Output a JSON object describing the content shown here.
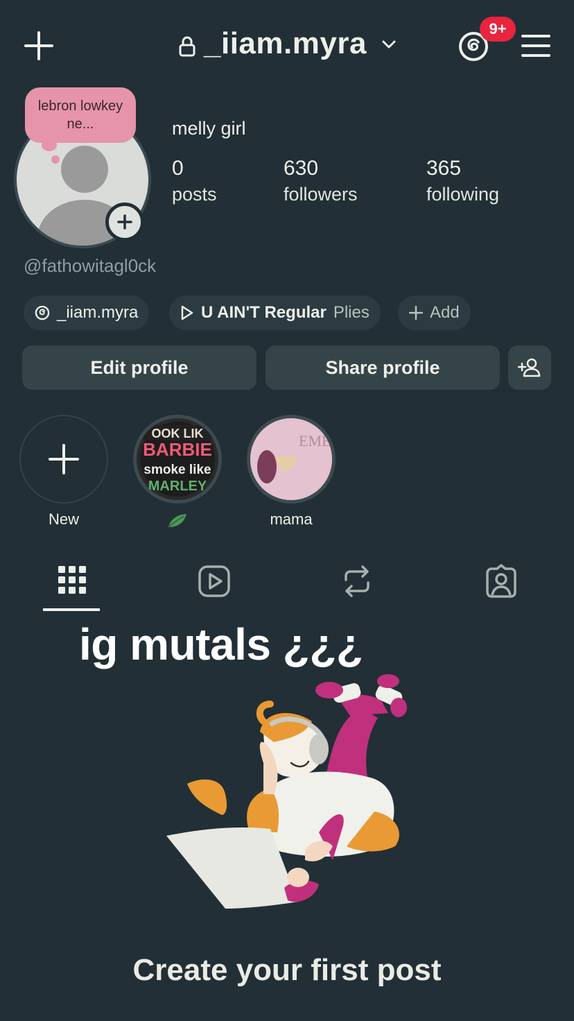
{
  "header": {
    "username": "_iiam.myra",
    "notification_badge": "9+",
    "badge_color": "#e8243f"
  },
  "profile": {
    "note": "lebron lowkey ne...",
    "full_name": "melly girl",
    "handle": "@fathowitagl0ck",
    "stats": [
      {
        "value": "0",
        "label": "posts"
      },
      {
        "value": "630",
        "label": "followers"
      },
      {
        "value": "365",
        "label": "following"
      }
    ],
    "chips": {
      "threads": "_iiam.myra",
      "music_title": "U AIN'T Regular",
      "music_artist": "Plies",
      "add": "Add"
    }
  },
  "actions": {
    "edit": "Edit profile",
    "share": "Share profile"
  },
  "highlights": [
    {
      "label": "New"
    },
    {
      "label": ""
    },
    {
      "label": "mama"
    }
  ],
  "tabs": [
    "grid-icon",
    "reels-icon",
    "reposts-icon",
    "tagged-icon"
  ],
  "overlay_text": "ig mutals ¿¿¿",
  "empty_state": {
    "title": "Create your first post"
  },
  "colors": {
    "background": "#222f36",
    "note_pink": "#e694aa",
    "button_bg": "#354449"
  }
}
